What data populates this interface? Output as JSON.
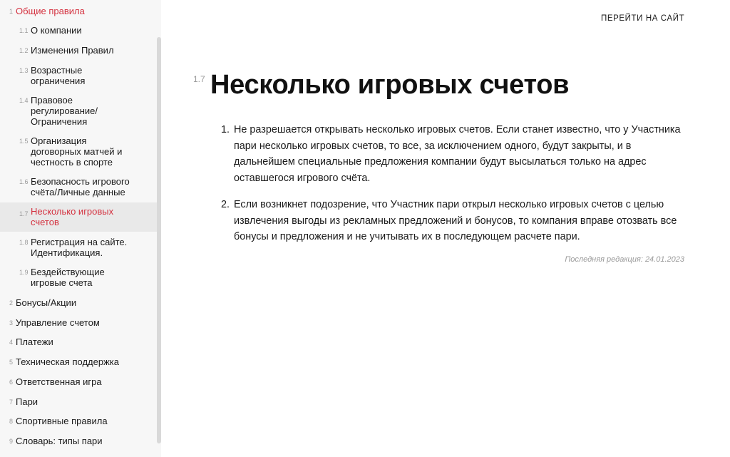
{
  "header": {
    "site_link": "ПЕРЕЙТИ НА САЙТ"
  },
  "sidebar": {
    "items": [
      {
        "num": "1",
        "label": "Общие правила"
      },
      {
        "num": "1.1",
        "label": "О компании"
      },
      {
        "num": "1.2",
        "label": "Изменения Правил"
      },
      {
        "num": "1.3",
        "label": "Возрастные ограничения"
      },
      {
        "num": "1.4",
        "label": "Правовое регулирование/ Ограничения"
      },
      {
        "num": "1.5",
        "label": "Организация договорных матчей и честность в спорте"
      },
      {
        "num": "1.6",
        "label": "Безопасность игрового счёта/Личные данные"
      },
      {
        "num": "1.7",
        "label": "Несколько игровых счетов"
      },
      {
        "num": "1.8",
        "label": "Регистрация на сайте. Идентификация."
      },
      {
        "num": "1.9",
        "label": "Бездействующие игровые счета"
      },
      {
        "num": "2",
        "label": "Бонусы/Акции"
      },
      {
        "num": "3",
        "label": "Управление счетом"
      },
      {
        "num": "4",
        "label": "Платежи"
      },
      {
        "num": "5",
        "label": "Техническая поддержка"
      },
      {
        "num": "6",
        "label": "Ответственная игра"
      },
      {
        "num": "7",
        "label": "Пари"
      },
      {
        "num": "8",
        "label": "Спортивные правила"
      },
      {
        "num": "9",
        "label": "Словарь: типы пари"
      }
    ]
  },
  "main": {
    "section_num": "1.7",
    "title": "Несколько игровых счетов",
    "rules": [
      {
        "marker": "1.",
        "text": "Не разрешается открывать несколько игровых счетов. Если станет известно, что у Участника пари несколько игровых счетов, то все, за исключением одного, будут закрыты, и в дальнейшем специальные предложения компании будут высылаться только на адрес оставшегося игрового счёта."
      },
      {
        "marker": "2.",
        "text": "Если возникнет подозрение, что Участник пари открыл несколько игровых счетов с целью извлечения выгоды из рекламных предложений и бонусов, то компания вправе отозвать все бонусы и предложения и не учитывать их в последующем расчете пари."
      }
    ],
    "last_edit": "Последняя редакция: 24.01.2023"
  },
  "colors": {
    "accent": "#d4313f",
    "sidebar_bg": "#f7f7f7",
    "active_bg": "#e9e9e9"
  }
}
